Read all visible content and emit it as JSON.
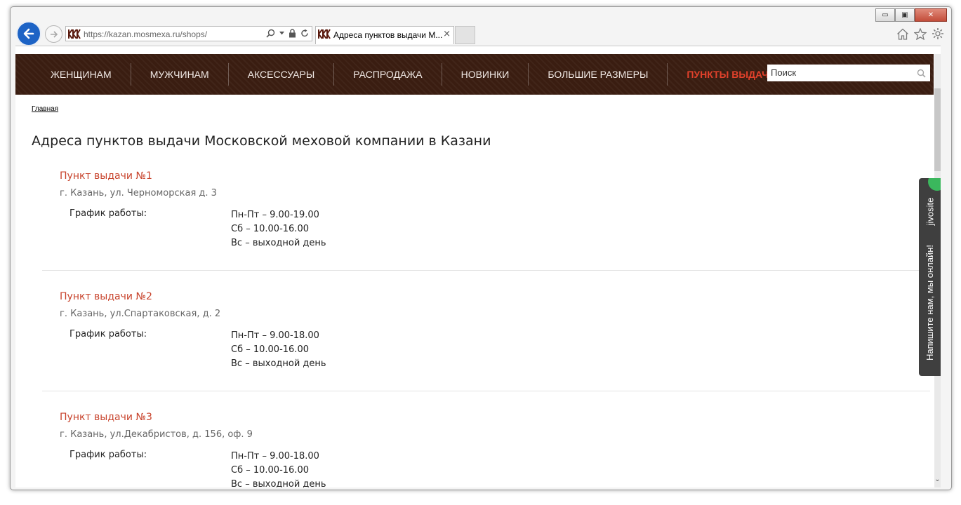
{
  "browser": {
    "url": "https://kazan.mosmexa.ru/shops/",
    "tab_title": "Адреса пунктов выдачи М...",
    "tab_close": "×",
    "window_min": "▭",
    "window_max": "▣",
    "window_close": "✕",
    "icons": [
      "back-arrow-icon",
      "forward-arrow-icon",
      "site-favicon-icon",
      "search-icon",
      "dropdown-icon",
      "lock-icon",
      "refresh-icon",
      "home-icon",
      "favorites-star-icon",
      "settings-gear-icon"
    ]
  },
  "nav": {
    "items": [
      {
        "label": "ЖЕНЩИНАМ"
      },
      {
        "label": "МУЖЧИНАМ"
      },
      {
        "label": "АКСЕССУАРЫ"
      },
      {
        "label": "РАСПРОДАЖА"
      },
      {
        "label": "НОВИНКИ"
      },
      {
        "label": "БОЛЬШИЕ РАЗМЕРЫ"
      },
      {
        "label": "ПУНКТЫ ВЫДАЧИ"
      }
    ],
    "active_index": 6,
    "active_color": "#e2412b",
    "background_color": "#3a1d11"
  },
  "search": {
    "placeholder": "Поиск"
  },
  "breadcrumb": "Главная",
  "page_title": "Адреса пунктов выдачи Московской меховой компании в Казани",
  "schedule_label": "График работы:",
  "shops": [
    {
      "title": "Пункт выдачи №1",
      "address": "г. Казань, ул. Черноморская д. 3",
      "schedule": [
        "Пн-Пт – 9.00-19.00",
        "Сб – 10.00-16.00",
        "Вс – выходной день"
      ]
    },
    {
      "title": "Пункт выдачи №2",
      "address": "г. Казань, ул.Спартаковская, д. 2",
      "schedule": [
        "Пн-Пт – 9.00-18.00",
        "Сб – 10.00-16.00",
        "Вс – выходной день"
      ]
    },
    {
      "title": "Пункт выдачи №3",
      "address": "г. Казань, ул.Декабристов, д. 156, оф. 9",
      "schedule": [
        "Пн-Пт – 9.00-18.00",
        "Сб – 10.00-16.00",
        "Вс – выходной день"
      ]
    }
  ],
  "chat_widget": {
    "brand": "jivosite",
    "text": "Напишите нам, мы онлайн!",
    "accent": "#3bb75d"
  },
  "scrollbar": {
    "down_arrow": "⌄"
  },
  "colors": {
    "shop_title": "#c8442d",
    "address": "#666666"
  }
}
